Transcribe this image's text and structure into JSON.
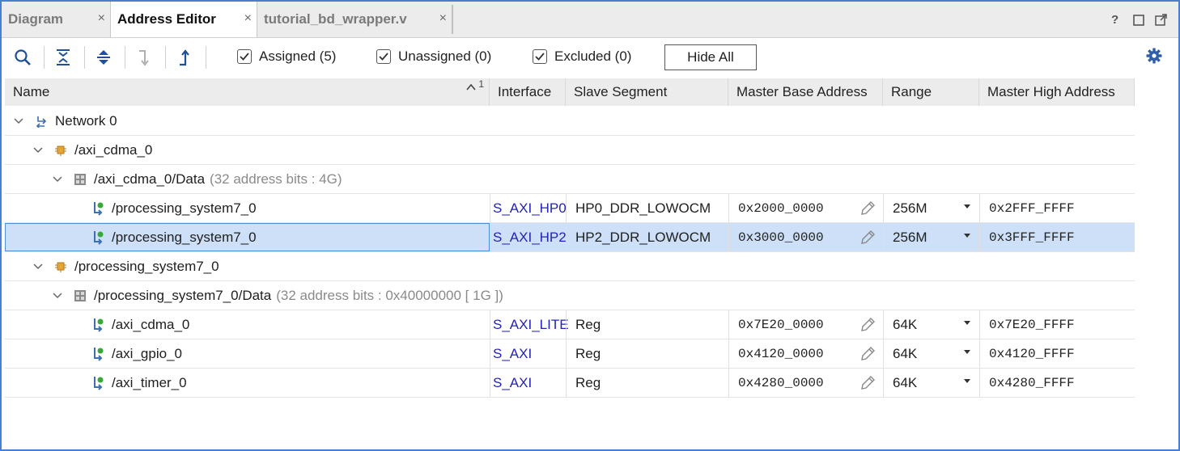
{
  "tabs": [
    {
      "label": "Diagram",
      "active": false
    },
    {
      "label": "Address Editor",
      "active": true
    },
    {
      "label": "tutorial_bd_wrapper.v",
      "active": false
    }
  ],
  "tab_close_glyph": "×",
  "window_controls": {
    "help": "?"
  },
  "toolbar": {
    "filters": [
      {
        "label": "Assigned (5)",
        "checked": true
      },
      {
        "label": "Unassigned (0)",
        "checked": true
      },
      {
        "label": "Excluded (0)",
        "checked": true
      }
    ],
    "hide_all_label": "Hide All"
  },
  "columns": {
    "name": "Name",
    "sort_indicator": "1",
    "interface": "Interface",
    "slave_segment": "Slave Segment",
    "master_base_address": "Master Base Address",
    "range": "Range",
    "master_high_address": "Master High Address"
  },
  "rows": [
    {
      "type": "network",
      "name": "Network 0"
    },
    {
      "type": "master",
      "name": "/axi_cdma_0"
    },
    {
      "type": "space",
      "name": "/axi_cdma_0/Data",
      "note": "(32 address bits : 4G)"
    },
    {
      "type": "segment",
      "name": "/processing_system7_0",
      "interface": "S_AXI_HP0",
      "slave_segment": "HP0_DDR_LOWOCM",
      "base": "0x2000_0000",
      "range": "256M",
      "high": "0x2FFF_FFFF",
      "selected": false
    },
    {
      "type": "segment",
      "name": "/processing_system7_0",
      "interface": "S_AXI_HP2",
      "slave_segment": "HP2_DDR_LOWOCM",
      "base": "0x3000_0000",
      "range": "256M",
      "high": "0x3FFF_FFFF",
      "selected": true
    },
    {
      "type": "master",
      "name": "/processing_system7_0"
    },
    {
      "type": "space",
      "name": "/processing_system7_0/Data",
      "note": "(32 address bits : 0x40000000 [ 1G ])"
    },
    {
      "type": "segment",
      "name": "/axi_cdma_0",
      "interface": "S_AXI_LITE",
      "slave_segment": "Reg",
      "base": "0x7E20_0000",
      "range": "64K",
      "high": "0x7E20_FFFF",
      "selected": false
    },
    {
      "type": "segment",
      "name": "/axi_gpio_0",
      "interface": "S_AXI",
      "slave_segment": "Reg",
      "base": "0x4120_0000",
      "range": "64K",
      "high": "0x4120_FFFF",
      "selected": false
    },
    {
      "type": "segment",
      "name": "/axi_timer_0",
      "interface": "S_AXI",
      "slave_segment": "Reg",
      "base": "0x4280_0000",
      "range": "64K",
      "high": "0x4280_FFFF",
      "selected": false
    }
  ],
  "colors": {
    "accent": "#4a7ed0",
    "selection": "#cde0f7",
    "interface_link": "#2323b8",
    "gear": "#2f5fa8"
  }
}
